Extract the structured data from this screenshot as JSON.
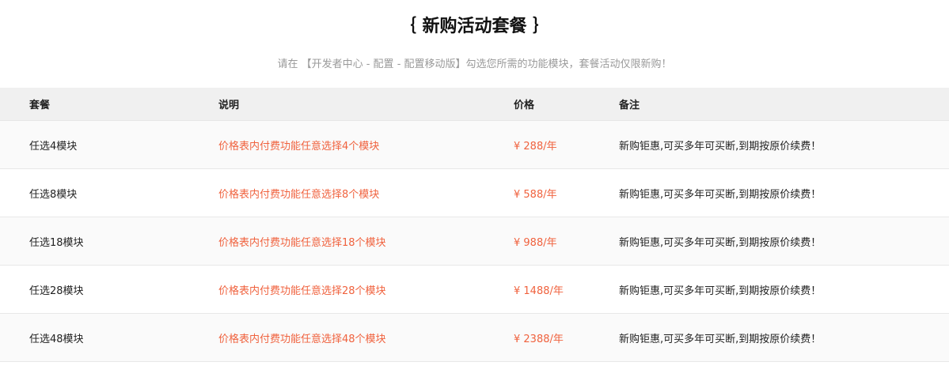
{
  "title": "｛ 新购活动套餐 ｝",
  "subtitle": "请在 【开发者中心 - 配置 - 配置移动版】勾选您所需的功能模块，套餐活动仅限新购！",
  "colors": {
    "accent": "#f0623e",
    "header_bg": "#f0f0f0",
    "row_alt_bg": "#fafafa"
  },
  "table": {
    "headers": [
      "套餐",
      "说明",
      "价格",
      "备注"
    ],
    "rows": [
      {
        "package": "任选4模块",
        "description": "价格表内付费功能任意选择4个模块",
        "price": "¥ 288/年",
        "note": "新购钜惠,可买多年可买断,到期按原价续费！"
      },
      {
        "package": "任选8模块",
        "description": "价格表内付费功能任意选择8个模块",
        "price": "¥ 588/年",
        "note": "新购钜惠,可买多年可买断,到期按原价续费！"
      },
      {
        "package": "任选18模块",
        "description": "价格表内付费功能任意选择18个模块",
        "price": "¥ 988/年",
        "note": "新购钜惠,可买多年可买断,到期按原价续费！"
      },
      {
        "package": "任选28模块",
        "description": "价格表内付费功能任意选择28个模块",
        "price": "¥ 1488/年",
        "note": "新购钜惠,可买多年可买断,到期按原价续费！"
      },
      {
        "package": "任选48模块",
        "description": "价格表内付费功能任意选择48个模块",
        "price": "¥ 2388/年",
        "note": "新购钜惠,可买多年可买断,到期按原价续费！"
      }
    ]
  }
}
